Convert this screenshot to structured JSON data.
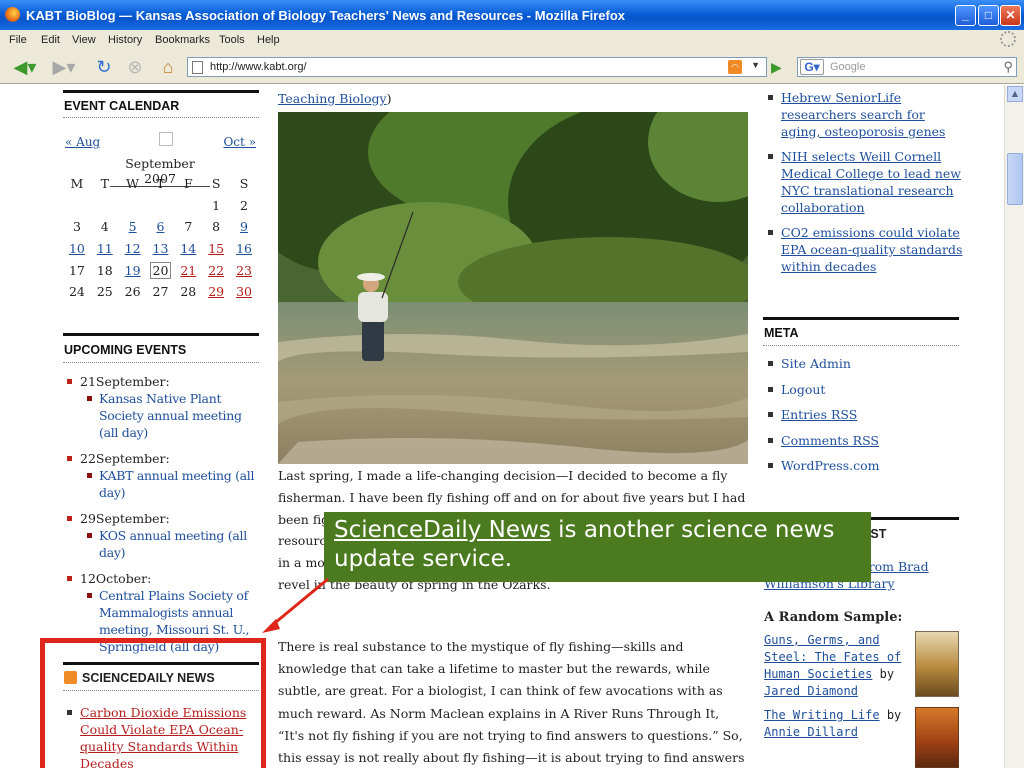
{
  "window": {
    "title": "KABT BioBlog — Kansas Association of Biology Teachers' News and Resources - Mozilla Firefox"
  },
  "menu": [
    "File",
    "Edit",
    "View",
    "History",
    "Bookmarks",
    "Tools",
    "Help"
  ],
  "nav": {
    "url": "http://www.kabt.org/",
    "search_placeholder": "Google"
  },
  "top_caption": {
    "link": "Teaching Biology",
    "after": ")"
  },
  "calendar": {
    "title": "EVENT CALENDAR",
    "prev": "« Aug",
    "next": "Oct »",
    "caption": "September 2007",
    "weekdays": [
      "M",
      "T",
      "W",
      "T",
      "F",
      "S",
      "S"
    ],
    "weeks": [
      [
        "",
        "",
        "",
        "",
        "",
        "1",
        "2"
      ],
      [
        "3",
        "4",
        "5",
        "6",
        "7",
        "8",
        "9"
      ],
      [
        "10",
        "11",
        "12",
        "13",
        "14",
        "15",
        "16"
      ],
      [
        "17",
        "18",
        "19",
        "20",
        "21",
        "22",
        "23"
      ],
      [
        "24",
        "25",
        "26",
        "27",
        "28",
        "29",
        "30"
      ]
    ]
  },
  "upcoming": {
    "title": "UPCOMING EVENTS",
    "groups": [
      {
        "date": "21September:",
        "event": "Kansas Native Plant Society annual meeting (all day)"
      },
      {
        "date": "22September:",
        "event": "KABT annual meeting (all day)"
      },
      {
        "date": "29September:",
        "event": "KOS annual meeting (all day)"
      },
      {
        "date": "12October:",
        "event": "Central Plains Society of Mammalogists annual meeting, Missouri St. U., Springfield (all day)"
      }
    ]
  },
  "sciencedaily": {
    "title": "SCIENCEDAILY NEWS",
    "items": [
      "Carbon Dioxide Emissions Could Violate EPA Ocean-quality Standards Within Decades"
    ]
  },
  "article": {
    "para1": "Last spring, I made a life-changing decision—I decided to become a fly fisherman. I have been fly fishing off and on for about five years but I had been fighting the urge to invest heavily in the sport. After extensive resource research, I learned that the exact skills required to fool a trout in a mountain stream. While I'm born and bred a prairie biologist, I do revel in the beauty of spring in the Ozarks.",
    "para2": "There is real substance to the mystique of fly fishing—skills and knowledge that can take a lifetime to master but the rewards, while subtle, are great. For a biologist, I can think of few avocations with as much reward. As Norm Maclean explains in A River Runs Through It, “It's not fly fishing if you are not trying to find answers to questions.” So, this essay is not really about fly fishing—it is about trying to find answers to questions……"
  },
  "news_links": [
    "Hebrew SeniorLife researchers search for aging, osteoporosis genes",
    "NIH selects Weill Cornell Medical College to lead new NYC translational research collaboration",
    "CO2 emissions could violate EPA ocean-quality standards within decades"
  ],
  "meta": {
    "title": "META",
    "items": [
      "Site Admin",
      "Logout",
      "Entries RSS",
      "Comments RSS",
      "WordPress.com"
    ]
  },
  "interest": {
    "title_tail": "REST",
    "link": "...alog of books from Brad Williamson's Library"
  },
  "sample": {
    "title": "A Random Sample:",
    "book1_title": "Guns, Germs, and Steel: The Fates of Human Societies",
    "book1_by": " by ",
    "book1_author": "Jared Diamond",
    "book2_title": "The Writing Life",
    "book2_by": " by ",
    "book2_author": "Annie Dillard"
  },
  "callout": {
    "link": "ScienceDaily News",
    "rest": " is another science news update service."
  }
}
